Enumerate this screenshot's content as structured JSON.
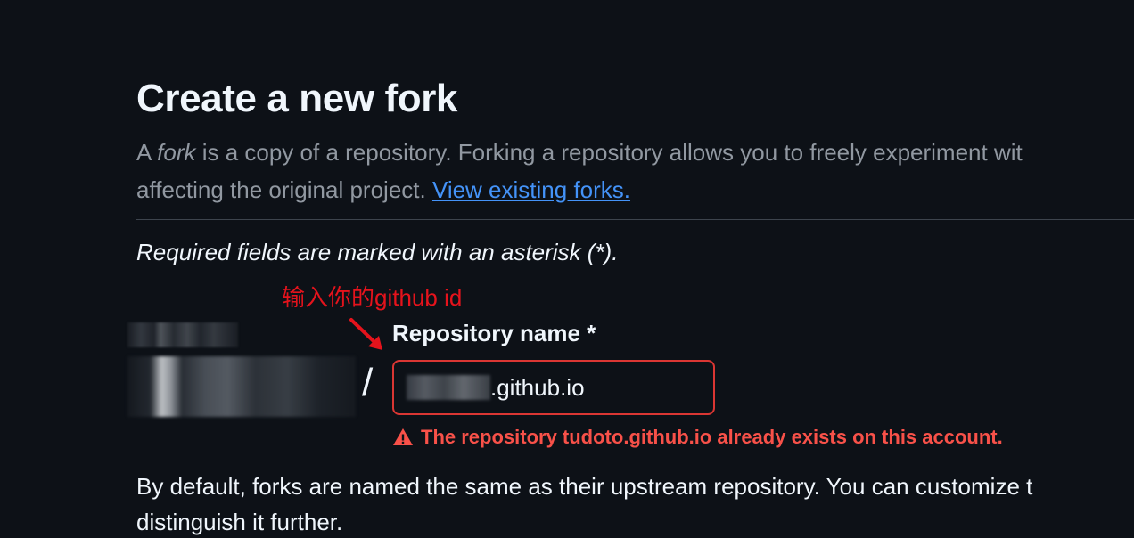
{
  "header": {
    "title": "Create a new fork"
  },
  "description": {
    "prefix": "A ",
    "fork_word": "fork",
    "line1_rest": " is a copy of a repository. Forking a repository allows you to freely experiment wit",
    "line2": "affecting the original project. ",
    "link_label": "View existing forks."
  },
  "form": {
    "required_note": "Required fields are marked with an asterisk (*).",
    "annotation": "输入你的github id",
    "slash": "/",
    "repo_label": "Repository name *",
    "repo_value_suffix": ".github.io",
    "error_message": "The repository tudoto.github.io already exists on this account.",
    "error_icon": "alert-icon",
    "error_color": "#f85149"
  },
  "footer_note": {
    "line1": "By default, forks are named the same as their upstream repository. You can customize t",
    "line2": "distinguish it further."
  },
  "colors": {
    "background": "#0d1117",
    "link": "#4493f8",
    "annotation": "#e5131c",
    "input_border_error": "#da3633"
  }
}
